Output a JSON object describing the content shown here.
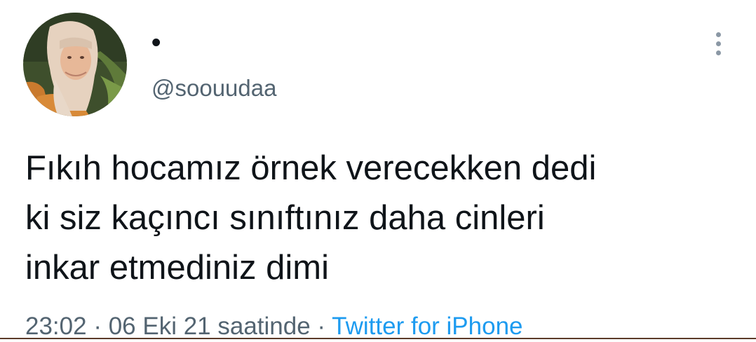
{
  "tweet": {
    "display_name": "•",
    "handle": "@soouudaa",
    "text": "Fıkıh hocamız örnek verecekken dedi\nki siz kaçıncı sınıftınız daha cinleri\ninkar etmediniz dimi",
    "time": "23:02",
    "separator1": " · ",
    "date": "06 Eki 21 saatinde",
    "separator2": " · ",
    "source": "Twitter for iPhone",
    "more_icon": "more-vertical-icon"
  },
  "colors": {
    "text_primary": "#0f1419",
    "text_secondary": "#536471",
    "link": "#1d9bf0"
  }
}
